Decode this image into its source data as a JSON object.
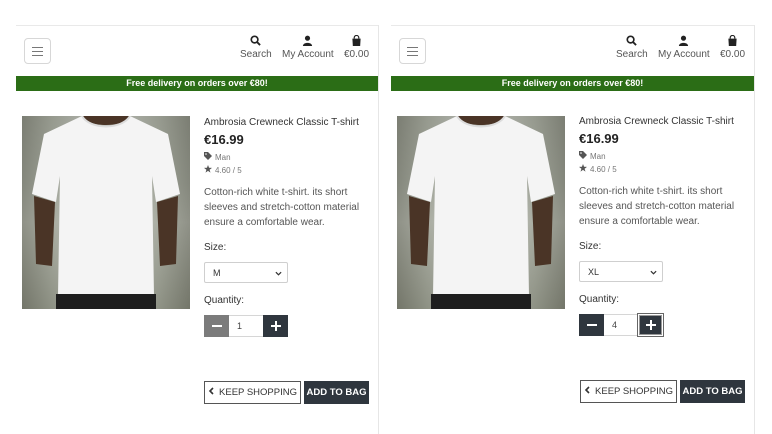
{
  "colors": {
    "banner_bg": "#2b6d16",
    "dark_button": "#2f363e"
  },
  "header": {
    "search_label": "Search",
    "account_label": "My Account",
    "bag_total": "€0.00",
    "icons": {
      "menu": "hamburger-icon",
      "search": "search-icon",
      "account": "user-icon",
      "bag": "shopping-bag-icon"
    }
  },
  "banner": {
    "text": "Free delivery on orders over €80!"
  },
  "screens": [
    {
      "product": {
        "name": "Ambrosia Crewneck Classic T-shirt",
        "price": "€16.99",
        "category": "Man",
        "rating": "4.60 / 5",
        "description": "Cotton-rich white t-shirt. its short sleeves and stretch-cotton material ensure a comfortable wear."
      },
      "size_label": "Size:",
      "size_value": "M",
      "quantity_label": "Quantity:",
      "quantity_value": "1",
      "keep_shopping": "KEEP SHOPPING",
      "add_to_bag": "ADD TO BAG"
    },
    {
      "product": {
        "name": "Ambrosia Crewneck Classic T-shirt",
        "price": "€16.99",
        "category": "Man",
        "rating": "4.60 / 5",
        "description": "Cotton-rich white t-shirt. its short sleeves and stretch-cotton material ensure a comfortable wear."
      },
      "size_label": "Size:",
      "size_value": "XL",
      "quantity_label": "Quantity:",
      "quantity_value": "4",
      "keep_shopping": "KEEP SHOPPING",
      "add_to_bag": "ADD TO BAG"
    }
  ]
}
